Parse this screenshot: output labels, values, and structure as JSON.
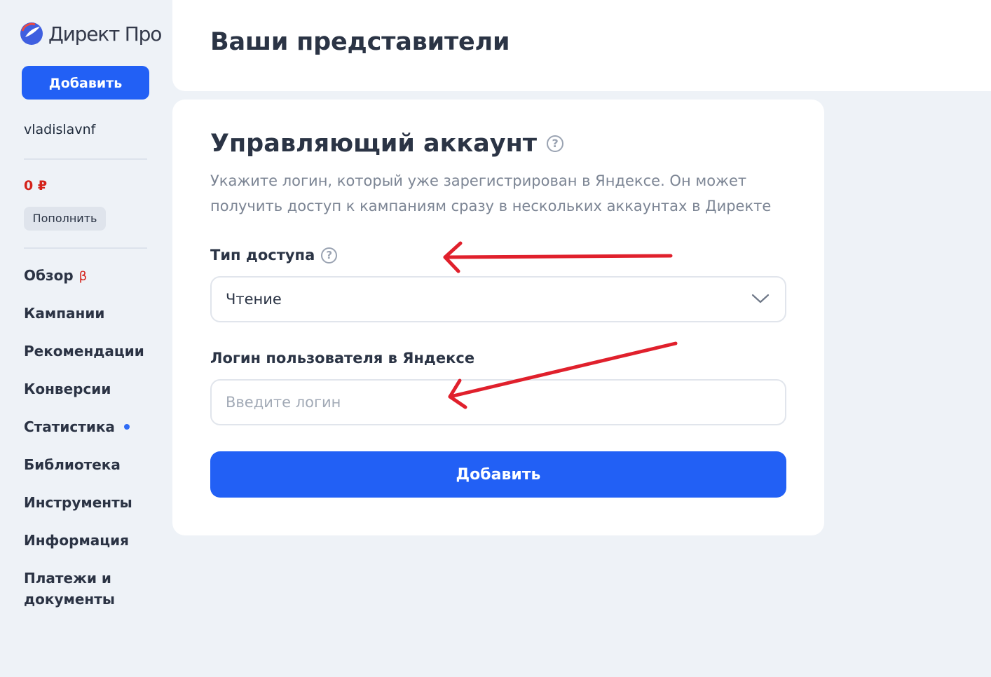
{
  "sidebar": {
    "logo_text": "Директ Про",
    "add_button_label": "Добавить",
    "username": "vladislavnf",
    "balance": "0 ₽",
    "topup_label": "Пополнить",
    "nav": [
      {
        "label": "Обзор",
        "badge": "β"
      },
      {
        "label": "Кампании"
      },
      {
        "label": "Рекомендации"
      },
      {
        "label": "Конверсии"
      },
      {
        "label": "Статистика",
        "has_dot": true
      },
      {
        "label": "Библиотека"
      },
      {
        "label": "Инструменты"
      },
      {
        "label": "Информация"
      },
      {
        "label": "Платежи и документы"
      }
    ]
  },
  "header": {
    "title": "Ваши представители"
  },
  "card": {
    "title": "Управляющий аккаунт",
    "description": "Укажите логин, который уже зарегистрирован в Яндексе. Он может получить доступ к кампаниям сразу в нескольких аккаунтах в Директе",
    "access_type_label": "Тип доступа",
    "access_type_value": "Чтение",
    "login_label": "Логин пользователя в Яндексе",
    "login_placeholder": "Введите логин",
    "login_value": "",
    "submit_label": "Добавить"
  },
  "icons": {
    "help": "question-circle-icon",
    "select": "chevron-down-icon",
    "annotation": "red-arrow-icon"
  },
  "colors": {
    "primary": "#2260f5",
    "balance_negative": "#d4231b",
    "annotation_arrow": "#e0202c",
    "background": "#eef2f7"
  }
}
